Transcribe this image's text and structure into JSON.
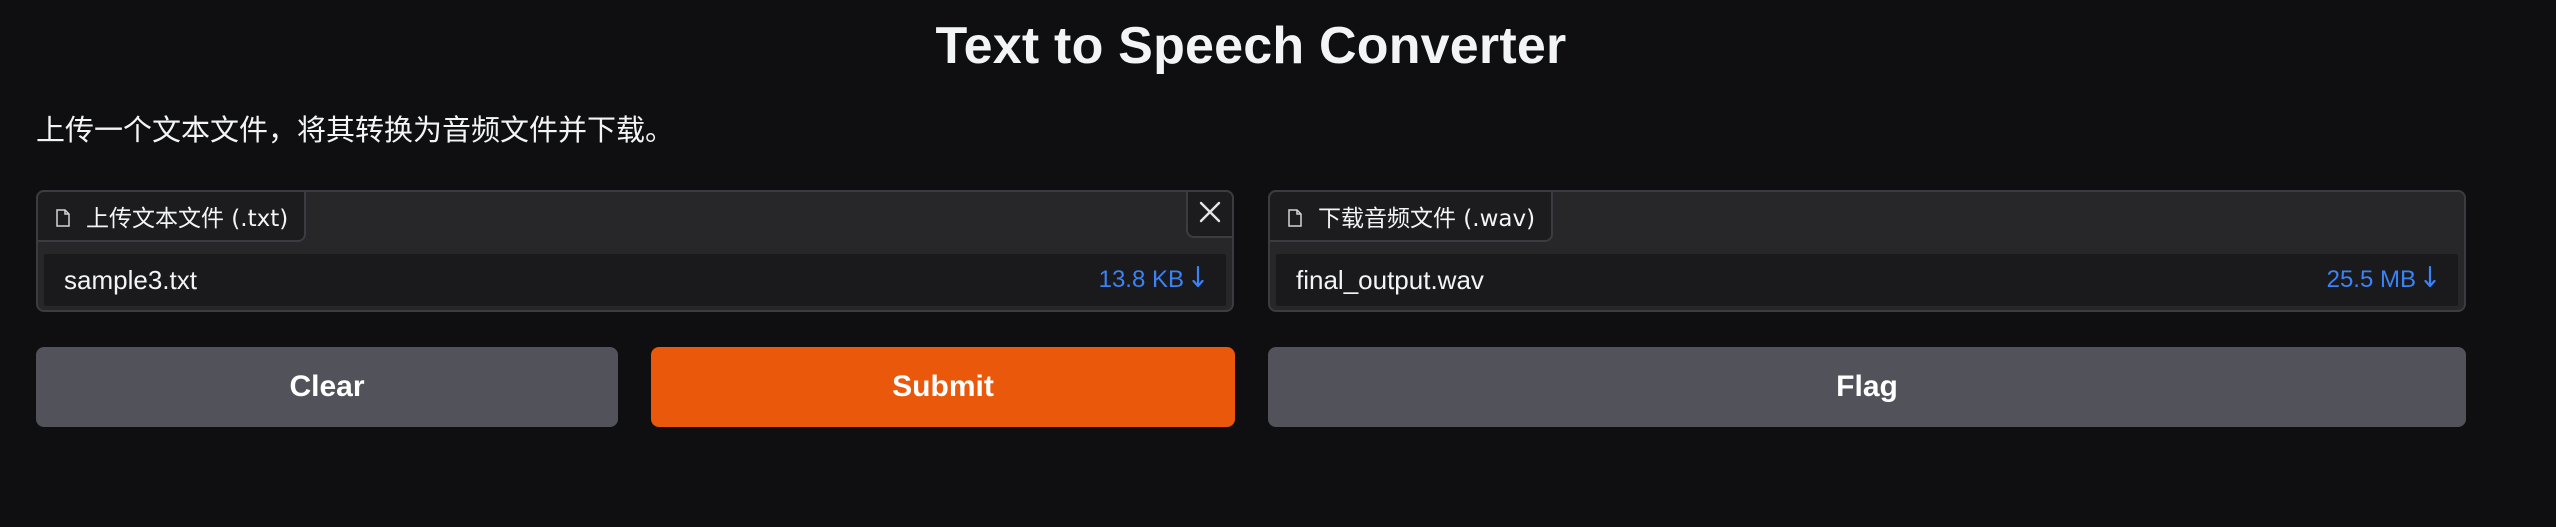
{
  "header": {
    "title": "Text to Speech Converter",
    "description": "上传一个文本文件，将其转换为音频文件并下载。"
  },
  "input_file": {
    "label": "上传文本文件 (.txt)",
    "file_name": "sample3.txt",
    "file_size": "13.8 KB",
    "label_icon": "file-icon",
    "clear_icon": "close-icon",
    "download_icon": "download-arrow-icon"
  },
  "output_file": {
    "label": "下载音频文件 (.wav)",
    "file_name": "final_output.wav",
    "file_size": "25.5 MB",
    "label_icon": "file-icon",
    "download_icon": "download-arrow-icon"
  },
  "buttons": {
    "clear": "Clear",
    "submit": "Submit",
    "flag": "Flag"
  },
  "colors": {
    "background": "#0f0f11",
    "panel": "#27272a",
    "secondary_button": "#52525b",
    "primary_button": "#ea580c",
    "link_blue": "#3b82f6"
  }
}
